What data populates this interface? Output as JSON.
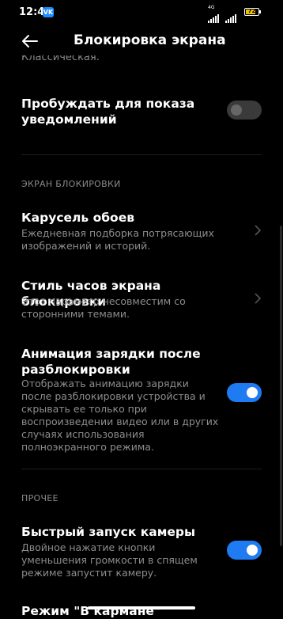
{
  "status": {
    "time": "12:47",
    "vk_badge": "VK",
    "network": "4G",
    "battery": "72"
  },
  "header": {
    "title": "Блокировка экрана"
  },
  "clipped_text": "Классическая.",
  "wake_item": {
    "title": "Пробуждать для показа уведомлений",
    "enabled": false
  },
  "lock_section": {
    "label": "ЭКРАН БЛОКИРОВКИ",
    "carousel": {
      "title": "Карусель обоев",
      "subtitle": "Ежедневная подборка потрясающих изображений и историй."
    },
    "clock_style": {
      "title": "Стиль часов экрана блокировки",
      "subtitle": "Этот параметр несовместим со сторонними темами."
    },
    "charging": {
      "title": "Анимация зарядки после разблокировки",
      "subtitle": "Отображать анимацию зарядки после разблокировки устройства и скрывать ее только при воспроизведении видео или в других случаях использования полноэкранного режима.",
      "enabled": true
    }
  },
  "other_section": {
    "label": "ПРОЧЕЕ",
    "camera": {
      "title": "Быстрый запуск камеры",
      "subtitle": "Двойное нажатие кнопки уменьшения громкости в спящем режиме запустит камеру.",
      "enabled": true
    },
    "pocket": {
      "title": "Режим \"В кармане\""
    }
  },
  "colors": {
    "accent": "#1e7bf2",
    "background": "#000000",
    "secondary_text": "#8d8d8d"
  },
  "icons": {
    "back": "arrow-left-icon",
    "chevron": "chevron-right-icon"
  }
}
